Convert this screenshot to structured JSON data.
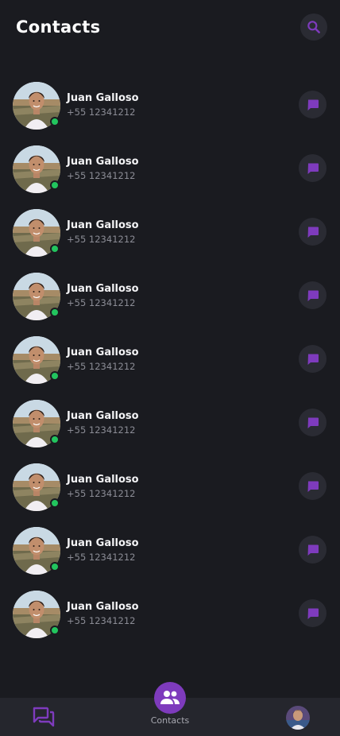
{
  "header": {
    "title": "Contacts",
    "search_icon": "search-icon"
  },
  "contacts": [
    {
      "name": "Juan Galloso",
      "phone": "+55 12341212",
      "online": true
    },
    {
      "name": "Juan Galloso",
      "phone": "+55 12341212",
      "online": true
    },
    {
      "name": "Juan Galloso",
      "phone": "+55 12341212",
      "online": true
    },
    {
      "name": "Juan Galloso",
      "phone": "+55 12341212",
      "online": true
    },
    {
      "name": "Juan Galloso",
      "phone": "+55 12341212",
      "online": true
    },
    {
      "name": "Juan Galloso",
      "phone": "+55 12341212",
      "online": true
    },
    {
      "name": "Juan Galloso",
      "phone": "+55 12341212",
      "online": true
    },
    {
      "name": "Juan Galloso",
      "phone": "+55 12341212",
      "online": true
    },
    {
      "name": "Juan Galloso",
      "phone": "+55 12341212",
      "online": true
    }
  ],
  "bottom_nav": {
    "chats_icon": "chats-icon",
    "contacts_label": "Contacts",
    "contacts_icon": "people-icon",
    "profile_icon": "avatar"
  },
  "colors": {
    "background": "#1a1b20",
    "accent": "#7e3bbd",
    "online": "#22c55e",
    "button_bg": "#2a2b33",
    "nav_bg": "#25262d"
  }
}
